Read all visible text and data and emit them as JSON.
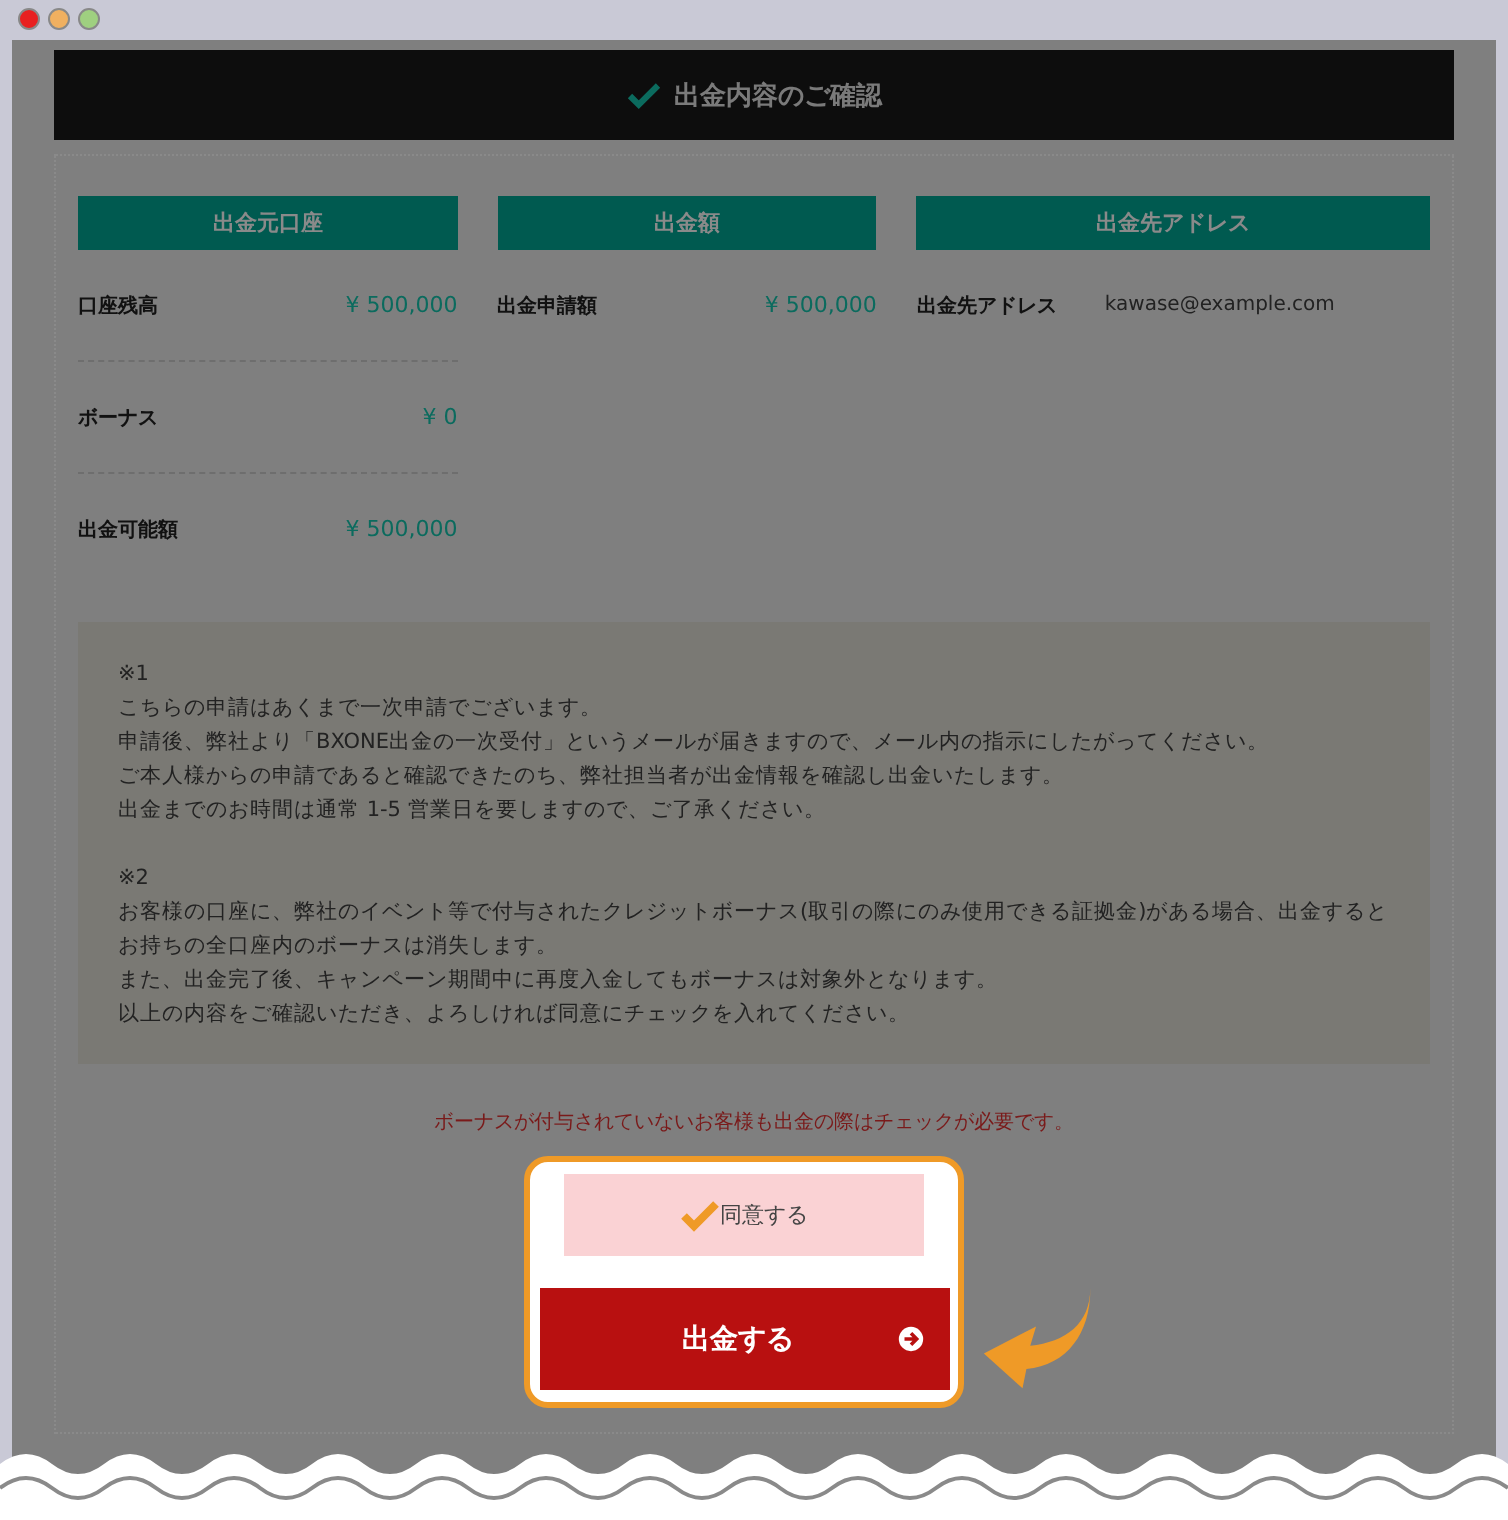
{
  "header": {
    "title": "出金内容のご確認"
  },
  "columns": [
    {
      "heading": "出金元口座",
      "rows": [
        {
          "label": "口座残高",
          "value": "¥ 500,000"
        },
        {
          "label": "ボーナス",
          "value": "¥ 0"
        },
        {
          "label": "出金可能額",
          "value": "¥ 500,000"
        }
      ]
    },
    {
      "heading": "出金額",
      "rows": [
        {
          "label": "出金申請額",
          "value": "¥ 500,000"
        }
      ]
    },
    {
      "heading": "出金先アドレス",
      "rows": [
        {
          "label": "出金先アドレス",
          "value": "kawase@example.com",
          "kind": "plain"
        }
      ]
    }
  ],
  "notes": [
    {
      "mark": "※1",
      "lines": [
        "こちらの申請はあくまで一次申請でございます。",
        "申請後、弊社より「BXONE出金の一次受付」というメールが届きますので、メール内の指示にしたがってください。",
        "ご本人様からの申請であると確認できたのち、弊社担当者が出金情報を確認し出金いたします。",
        "出金までのお時間は通常 1-5 営業日を要しますので、ご了承ください。"
      ]
    },
    {
      "mark": "※2",
      "lines": [
        "お客様の口座に、弊社のイベント等で付与されたクレジットボーナス(取引の際にのみ使用できる証拠金)がある場合、出金するとお持ちの全口座内のボーナスは消失します。",
        "また、出金完了後、キャンペーン期間中に再度入金してもボーナスは対象外となります。",
        "以上の内容をご確認いただき、よろしければ同意にチェックを入れてください。"
      ]
    }
  ],
  "warning": "ボーナスが付与されていないお客様も出金の際はチェックが必要です。",
  "agree": {
    "label": "同意する",
    "checked": true
  },
  "submit": {
    "label": "出金する"
  }
}
